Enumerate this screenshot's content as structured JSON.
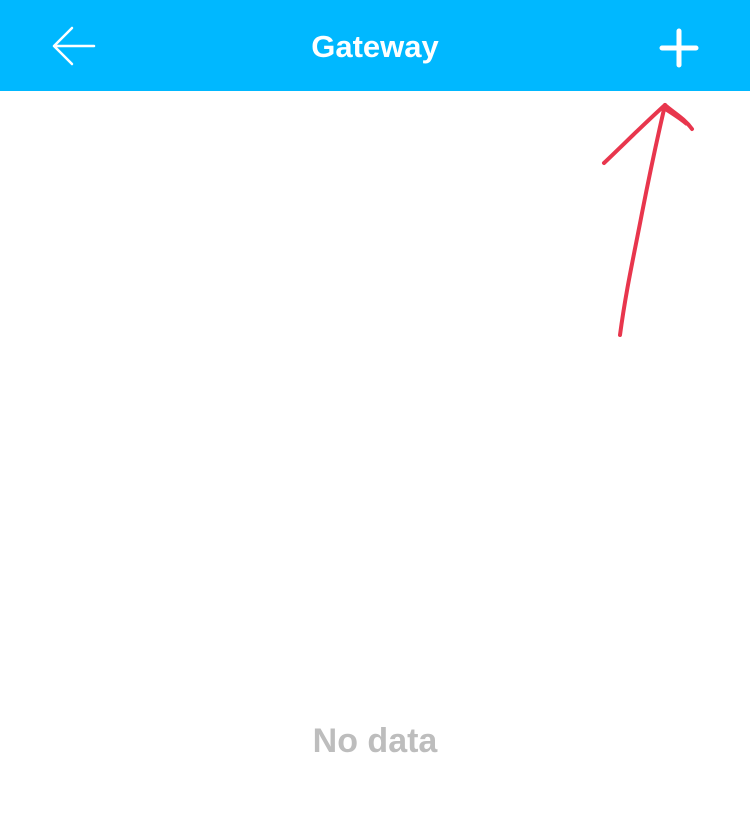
{
  "header": {
    "title": "Gateway",
    "back_icon": "arrow-left-icon",
    "add_icon": "plus-icon"
  },
  "main": {
    "empty_message": "No data"
  },
  "colors": {
    "nav_background": "#00b8ff",
    "nav_text": "#ffffff",
    "empty_text": "#bdbdbd",
    "annotation": "#e8364d"
  },
  "annotation": {
    "type": "hand-drawn arrow",
    "target": "add-button"
  }
}
